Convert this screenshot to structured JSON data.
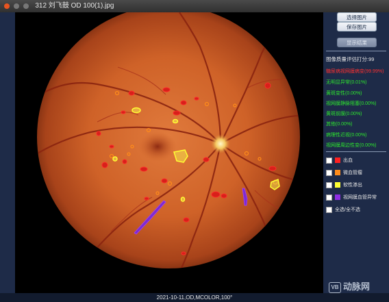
{
  "window": {
    "title": "312 刘飞鼓 OD 100(1).jpg",
    "controls": [
      "close",
      "minimize",
      "maximize"
    ],
    "control_colors": [
      "#e95420",
      "#777777",
      "#777777"
    ]
  },
  "image": {
    "description_icon": "fundus-image"
  },
  "panel": {
    "buttons": {
      "select_image": "选择图片",
      "save_image": "保存图片",
      "show_result": "显示结果"
    },
    "score_label": "图像质量评估打分:99",
    "diseases": [
      {
        "label": "糖尿病视网膜病变(99.99%)",
        "color": "#ff3030"
      },
      {
        "label": "无明显异常(0.01%)",
        "color": "#2ee82e"
      },
      {
        "label": "黄斑变性(0.00%)",
        "color": "#2ee82e"
      },
      {
        "label": "视网膜静脉阻塞(0.00%)",
        "color": "#2ee82e"
      },
      {
        "label": "黄斑前膜(0.00%)",
        "color": "#2ee82e"
      },
      {
        "label": "其他(0.00%)",
        "color": "#2ee82e"
      },
      {
        "label": "病理性近视(0.00%)",
        "color": "#2ee82e"
      },
      {
        "label": "视网膜周边性变(0.00%)",
        "color": "#2ee82e"
      }
    ],
    "legend": [
      {
        "label": "出血",
        "color": "#ff2020"
      },
      {
        "label": "微血管瘤",
        "color": "#ff8c1a"
      },
      {
        "label": "软性渗出",
        "color": "#ffff33"
      },
      {
        "label": "视网膜血管异常",
        "color": "#8e2de2"
      },
      {
        "label": "全选/全不选",
        "color": ""
      }
    ]
  },
  "status": {
    "text": "2021-10-11,OD,MCOLOR,100°"
  },
  "watermark": {
    "logo": "VB",
    "text": "动脉网"
  },
  "colors": {
    "hemorrhage": "#ff2020",
    "microaneurysm": "#ff8c1a",
    "soft_exudate": "#ffff33",
    "vascular_abnormality": "#8e2de2",
    "accent_bg": "#1e2b48"
  }
}
